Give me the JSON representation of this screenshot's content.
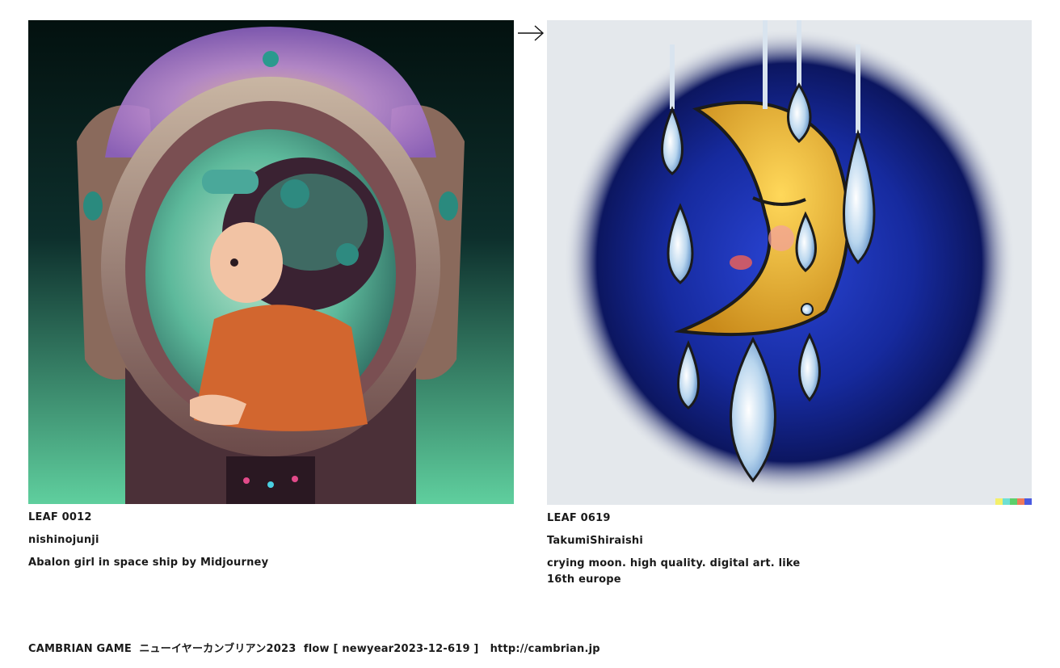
{
  "left_card": {
    "artwork_icon": "astronaut-girl-porthole-image",
    "leaf_id": "LEAF 0012",
    "author": "nishinojunji",
    "description": "Abalon girl in space ship by Midjourney"
  },
  "flow_arrow_icon": "right-arrow-icon",
  "right_card": {
    "artwork_icon": "crying-moon-image",
    "leaf_id": "LEAF 0619",
    "author": "TakumiShiraishi",
    "description": "crying moon. high quality. digital art. like 16th europe",
    "signature_colors": [
      "#f4f06a",
      "#6ee0d4",
      "#5ccf6b",
      "#f07a5a",
      "#4a5ae0"
    ]
  },
  "footer": {
    "text": "CAMBRIAN GAME  ニューイヤーカンブリアン2023  flow [ newyear2023-12-619 ]",
    "url": "http://cambrian.jp"
  }
}
